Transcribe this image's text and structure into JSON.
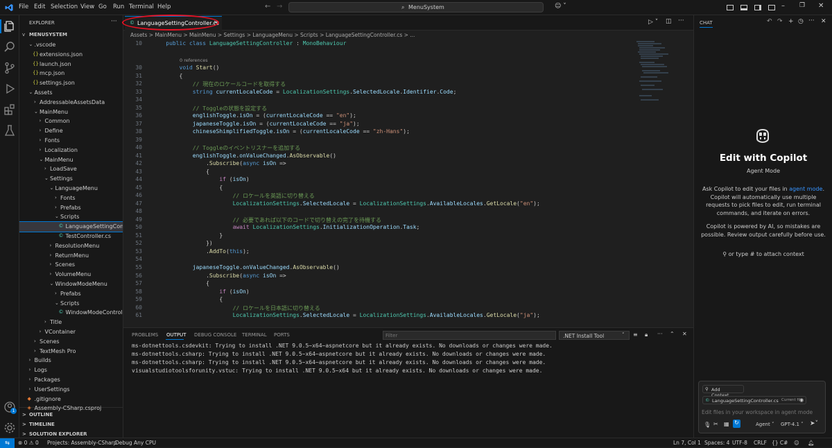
{
  "titlebar": {
    "menus": [
      "File",
      "Edit",
      "Selection",
      "View",
      "Go",
      "Run",
      "Terminal",
      "Help"
    ],
    "search": "MenuSystem"
  },
  "explorer": {
    "header": "EXPLORER",
    "root": "MENUSYSTEM",
    "items": [
      {
        "label": ".vscode",
        "indent": 1,
        "chev": "v"
      },
      {
        "label": "extensions.json",
        "indent": 2,
        "icon": "{}"
      },
      {
        "label": "launch.json",
        "indent": 2,
        "icon": "{}"
      },
      {
        "label": "mcp.json",
        "indent": 2,
        "icon": "{}"
      },
      {
        "label": "settings.json",
        "indent": 2,
        "icon": "{}"
      },
      {
        "label": "Assets",
        "indent": 1,
        "chev": "v"
      },
      {
        "label": "AddressableAssetsData",
        "indent": 2,
        "chev": ">"
      },
      {
        "label": "MainMenu",
        "indent": 2,
        "chev": "v"
      },
      {
        "label": "Common",
        "indent": 3,
        "chev": ">"
      },
      {
        "label": "Define",
        "indent": 3,
        "chev": ">"
      },
      {
        "label": "Fonts",
        "indent": 3,
        "chev": ">"
      },
      {
        "label": "Localization",
        "indent": 3,
        "chev": ">"
      },
      {
        "label": "MainMenu",
        "indent": 3,
        "chev": "v"
      },
      {
        "label": "LoadSave",
        "indent": 4,
        "chev": ">"
      },
      {
        "label": "Settings",
        "indent": 4,
        "chev": "v"
      },
      {
        "label": "LanguageMenu",
        "indent": 5,
        "chev": "v"
      },
      {
        "label": "Fonts",
        "indent": 6,
        "chev": ">"
      },
      {
        "label": "Prefabs",
        "indent": 6,
        "chev": ">"
      },
      {
        "label": "Scripts",
        "indent": 6,
        "chev": "v"
      },
      {
        "label": "LanguageSettingControll...",
        "indent": 7,
        "icon": "C#",
        "selected": true
      },
      {
        "label": "TestController.cs",
        "indent": 7,
        "icon": "C#"
      },
      {
        "label": "ResolutionMenu",
        "indent": 5,
        "chev": ">"
      },
      {
        "label": "ReturnMenu",
        "indent": 5,
        "chev": ">"
      },
      {
        "label": "Scenes",
        "indent": 5,
        "chev": ">"
      },
      {
        "label": "VolumeMenu",
        "indent": 5,
        "chev": ">"
      },
      {
        "label": "WindowModeMenu",
        "indent": 5,
        "chev": "v"
      },
      {
        "label": "Prefabs",
        "indent": 6,
        "chev": ">"
      },
      {
        "label": "Scripts",
        "indent": 6,
        "chev": "v"
      },
      {
        "label": "WindowModeController.cs",
        "indent": 7,
        "icon": "C#"
      },
      {
        "label": "Title",
        "indent": 4,
        "chev": ">"
      },
      {
        "label": "VContainer",
        "indent": 3,
        "chev": ">"
      },
      {
        "label": "Scenes",
        "indent": 2,
        "chev": ">"
      },
      {
        "label": "TextMesh Pro",
        "indent": 2,
        "chev": ">"
      },
      {
        "label": "Builds",
        "indent": 1,
        "chev": ">"
      },
      {
        "label": "Logs",
        "indent": 1,
        "chev": ">"
      },
      {
        "label": "Packages",
        "indent": 1,
        "chev": ">"
      },
      {
        "label": "UserSettings",
        "indent": 1,
        "chev": ">"
      },
      {
        "label": ".gitignore",
        "indent": 1,
        "icon": "◆"
      },
      {
        "label": "Assembly-CSharp.csproj",
        "indent": 1,
        "icon": "◈"
      }
    ],
    "sections": [
      "OUTLINE",
      "TIMELINE",
      "SOLUTION EXPLORER"
    ]
  },
  "editor": {
    "tab": "LanguageSettingController.cs",
    "breadcrumb": "Assets > MainMenu > MainMenu > Settings > LanguageMenu > Scripts > LanguageSettingController.cs > ...",
    "references": "0 references",
    "lines": [
      {
        "n": "10",
        "html": "    <span class='kw'>public class</span> <span class='ty'>LanguageSettingController</span> : <span class='ty'>MonoBehaviour</span>"
      },
      {
        "n": "30",
        "html": "        <span class='kw'>void</span> <span class='fn'>Start</span>()"
      },
      {
        "n": "31",
        "html": "        {"
      },
      {
        "n": "32",
        "html": "            <span class='cm'>// 現在のロケールコードを取得する</span>"
      },
      {
        "n": "33",
        "html": "            <span class='kw'>string</span> <span class='vr'>currentLocaleCode</span> = <span class='ty'>LocalizationSettings</span>.<span class='vr'>SelectedLocale</span>.<span class='vr'>Identifier</span>.<span class='vr'>Code</span>;"
      },
      {
        "n": "34",
        "html": ""
      },
      {
        "n": "35",
        "html": "            <span class='cm'>// Toggleの状態を設定する</span>"
      },
      {
        "n": "36",
        "html": "            <span class='vr'>englishToggle</span>.<span class='vr'>isOn</span> = (<span class='vr'>currentLocaleCode</span> == <span class='st'>\"en\"</span>);"
      },
      {
        "n": "37",
        "html": "            <span class='vr'>japaneseToggle</span>.<span class='vr'>isOn</span> = (<span class='vr'>currentLocaleCode</span> == <span class='st'>\"ja\"</span>);"
      },
      {
        "n": "38",
        "html": "            <span class='vr'>chineseShimplifiedToggle</span>.<span class='vr'>isOn</span> = (<span class='vr'>currentLocaleCode</span> == <span class='st'>\"zh-Hans\"</span>);"
      },
      {
        "n": "39",
        "html": ""
      },
      {
        "n": "40",
        "html": "            <span class='cm'>// Toggleのイベントリスナーを追加する</span>"
      },
      {
        "n": "41",
        "html": "            <span class='vr'>englishToggle</span>.<span class='vr'>onValueChanged</span>.<span class='fn'>AsObservable</span>()"
      },
      {
        "n": "42",
        "html": "                .<span class='fn'>Subscribe</span>(<span class='kw'>async</span> <span class='vr'>isOn</span> =>"
      },
      {
        "n": "43",
        "html": "                {"
      },
      {
        "n": "44",
        "html": "                    <span class='kw2'>if</span> (<span class='vr'>isOn</span>)"
      },
      {
        "n": "45",
        "html": "                    {"
      },
      {
        "n": "46",
        "html": "                        <span class='cm'>// ロケールを英語に切り替える</span>"
      },
      {
        "n": "47",
        "html": "                        <span class='ty'>LocalizationSettings</span>.<span class='vr'>SelectedLocale</span> = <span class='ty'>LocalizationSettings</span>.<span class='vr'>AvailableLocales</span>.<span class='fn'>GetLocale</span>(<span class='st'>\"en\"</span>);"
      },
      {
        "n": "48",
        "html": ""
      },
      {
        "n": "49",
        "html": "                        <span class='cm'>// 必要であれば以下のコードで切り替えの完了を待機する</span>"
      },
      {
        "n": "50",
        "html": "                        <span class='kw2'>await</span> <span class='ty'>LocalizationSettings</span>.<span class='vr'>InitializationOperation</span>.<span class='vr'>Task</span>;"
      },
      {
        "n": "51",
        "html": "                    }"
      },
      {
        "n": "52",
        "html": "                })"
      },
      {
        "n": "53",
        "html": "                .<span class='fn'>AddTo</span>(<span class='kw'>this</span>);"
      },
      {
        "n": "54",
        "html": ""
      },
      {
        "n": "55",
        "html": "            <span class='vr'>japaneseToggle</span>.<span class='vr'>onValueChanged</span>.<span class='fn'>AsObservable</span>()"
      },
      {
        "n": "56",
        "html": "                .<span class='fn'>Subscribe</span>(<span class='kw'>async</span> <span class='vr'>isOn</span> =>"
      },
      {
        "n": "57",
        "html": "                {"
      },
      {
        "n": "58",
        "html": "                    <span class='kw2'>if</span> (<span class='vr'>isOn</span>)"
      },
      {
        "n": "59",
        "html": "                    {"
      },
      {
        "n": "60",
        "html": "                        <span class='cm'>// ロケールを日本語に切り替える</span>"
      },
      {
        "n": "61",
        "html": "                        <span class='ty'>LocalizationSettings</span>.<span class='vr'>SelectedLocale</span> = <span class='ty'>LocalizationSettings</span>.<span class='vr'>AvailableLocales</span>.<span class='fn'>GetLocale</span>(<span class='st'>\"ja\"</span>);"
      }
    ]
  },
  "panel": {
    "tabs": [
      "PROBLEMS",
      "OUTPUT",
      "DEBUG CONSOLE",
      "TERMINAL",
      "PORTS"
    ],
    "active_tab": "OUTPUT",
    "filter_placeholder": "Filter",
    "source": ".NET Install Tool",
    "lines": [
      "ms-dotnettools.csdevkit: Trying to install .NET 9.0.5~x64~aspnetcore but it already exists. No downloads or changes were made.",
      "ms-dotnettools.csharp: Trying to install .NET 9.0.5~x64~aspnetcore but it already exists. No downloads or changes were made.",
      "ms-dotnettools.csharp: Trying to install .NET 9.0.5~x64~aspnetcore but it already exists. No downloads or changes were made.",
      "visualstudiotoolsforunity.vstuc: Trying to install .NET 9.0.5~x64 but it already exists. No downloads or changes were made."
    ]
  },
  "chat": {
    "header": "CHAT",
    "title": "Edit with Copilot",
    "mode": "Agent Mode",
    "desc_pre": "Ask Copilot to edit your files in ",
    "desc_link": "agent mode",
    "desc_post": ". Copilot will automatically use multiple requests to pick files to edit, run terminal commands, and iterate on errors.",
    "disclaimer": "Copilot is powered by AI, so mistakes are possible. Review output carefully before use.",
    "attach_hint": "or type # to attach context",
    "add_context": "Add Context...",
    "current_file": "LanguageSettingController.cs",
    "current_file_tag": "Current file",
    "input_placeholder": "Edit files in your workspace in agent mode",
    "agent_label": "Agent",
    "model_label": "GPT-4.1"
  },
  "status": {
    "problems": "0",
    "warnings": "0",
    "projects": "Projects: Assembly-CSharp",
    "debug": "Debug Any CPU",
    "position": "Ln 7, Col 1",
    "spaces": "Spaces: 4",
    "encoding": "UTF-8",
    "eol": "CRLF",
    "lang": "{} C#",
    "badge": "1"
  },
  "colors": {
    "accent": "#0078d4",
    "highlight": "#e81123"
  }
}
